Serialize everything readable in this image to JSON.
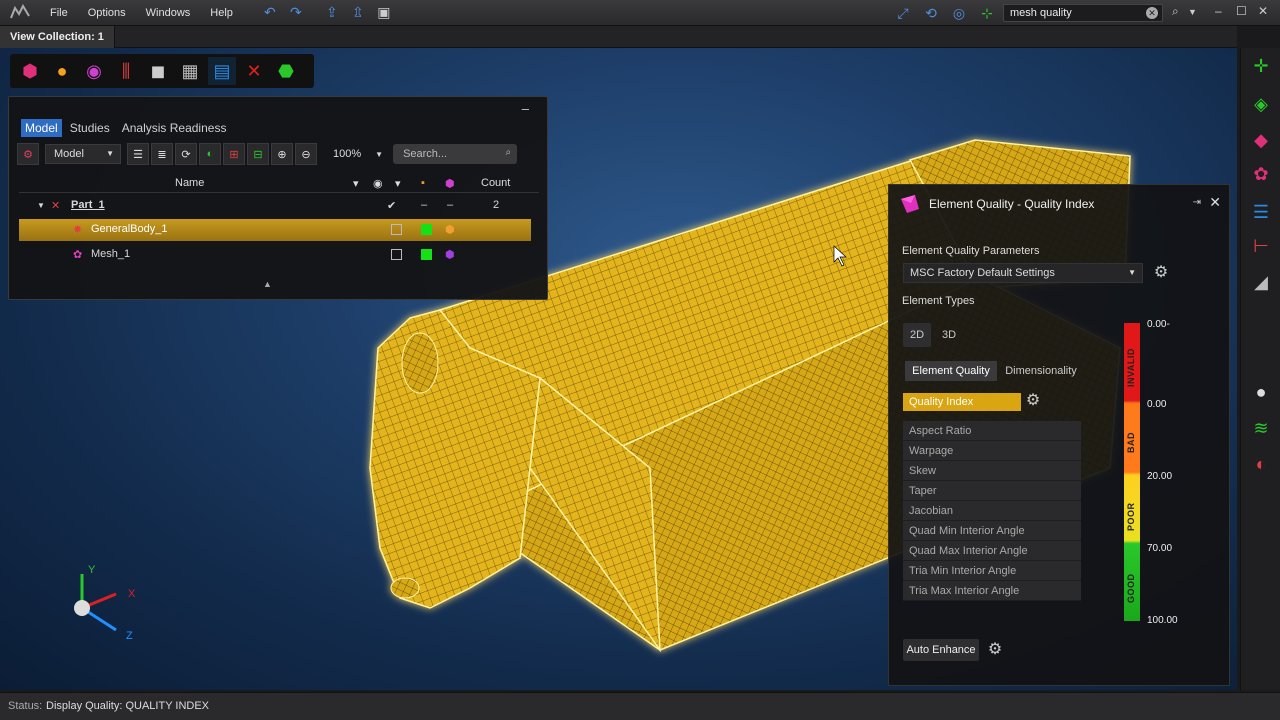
{
  "menubar": {
    "items": [
      "File",
      "Options",
      "Windows",
      "Help"
    ],
    "search_value": "mesh quality"
  },
  "tabstrip": {
    "view_tab": "View Collection: 1"
  },
  "model_panel": {
    "tabs": [
      "Model",
      "Studies",
      "Analysis Readiness"
    ],
    "active_tab": "Model",
    "model_select": "Model",
    "zoom": "100%",
    "search_placeholder": "Search...",
    "columns": {
      "name": "Name",
      "count": "Count"
    },
    "rows": [
      {
        "name": "Part_1",
        "count": "2",
        "dash1": "–",
        "dash2": "–"
      },
      {
        "name": "GeneralBody_1"
      },
      {
        "name": "Mesh_1"
      }
    ]
  },
  "eq_panel": {
    "title": "Element Quality - Quality Index",
    "params_label": "Element Quality Parameters",
    "params_value": "MSC Factory Default Settings",
    "types_label": "Element Types",
    "type_2d": "2D",
    "type_3d": "3D",
    "tab_quality": "Element Quality",
    "tab_dimensionality": "Dimensionality",
    "selected_metric": "Quality Index",
    "metrics": [
      "Aspect Ratio",
      "Warpage",
      "Skew",
      "Taper",
      "Jacobian",
      "Quad Min Interior Angle",
      "Quad Max Interior Angle",
      "Tria Min Interior Angle",
      "Tria Max Interior Angle"
    ],
    "colorbar": {
      "bands": [
        "INVALID",
        "BAD",
        "POOR",
        "GOOD"
      ],
      "ticks": [
        "0.00-",
        "0.00",
        "20.00",
        "70.00",
        "100.00"
      ]
    },
    "auto_enhance": "Auto Enhance"
  },
  "triad": {
    "x": "X",
    "y": "Y",
    "z": "Z"
  },
  "status": {
    "label": "Status:",
    "text": "Display Quality: QUALITY INDEX"
  },
  "colors": {
    "accent_blue": "#2f6cc4",
    "selection_gold": "#c89a20",
    "mesh_yellow": "#e8b820"
  }
}
